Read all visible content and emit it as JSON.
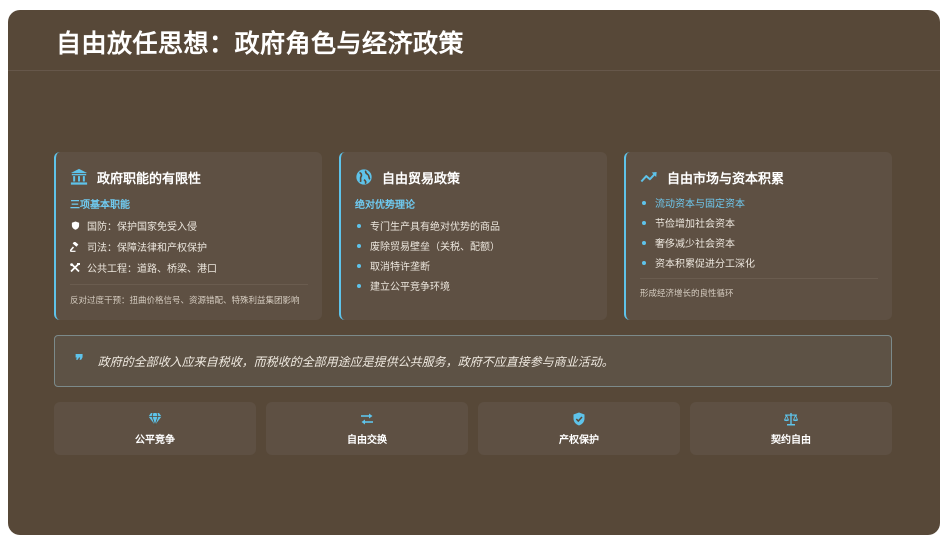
{
  "title": "自由放任思想：政府角色与经济政策",
  "cards": [
    {
      "icon": "government-building-icon",
      "title": "政府职能的有限性",
      "subhead": "三项基本职能",
      "items": [
        {
          "icon": "shield-icon",
          "text": "国防：保护国家免受入侵"
        },
        {
          "icon": "gavel-icon",
          "text": "司法：保障法律和产权保护"
        },
        {
          "icon": "tools-icon",
          "text": "公共工程：道路、桥梁、港口"
        }
      ],
      "note": "反对过度干预：扭曲价格信号、资源错配、特殊利益集团影响"
    },
    {
      "icon": "globe-icon",
      "title": "自由贸易政策",
      "subhead": "绝对优势理论",
      "items": [
        {
          "text": "专门生产具有绝对优势的商品"
        },
        {
          "text": "废除贸易壁垒（关税、配额）"
        },
        {
          "text": "取消特许垄断"
        },
        {
          "text": "建立公平竞争环境"
        }
      ]
    },
    {
      "icon": "trending-up-icon",
      "title": "自由市场与资本积累",
      "items": [
        {
          "text": "流动资本与固定资本",
          "highlight": true
        },
        {
          "text": "节俭增加社会资本"
        },
        {
          "text": "奢侈减少社会资本"
        },
        {
          "text": "资本积累促进分工深化"
        }
      ],
      "note": "形成经济增长的良性循环"
    }
  ],
  "quote": {
    "icon": "quote-icon",
    "mark": "❞",
    "text": "政府的全部收入应来自税收，而税收的全部用途应是提供公共服务，政府不应直接参与商业活动。"
  },
  "principles": [
    {
      "icon": "diamond-icon",
      "label": "公平竞争"
    },
    {
      "icon": "exchange-icon",
      "label": "自由交换"
    },
    {
      "icon": "shield-check-icon",
      "label": "产权保护"
    },
    {
      "icon": "scale-icon",
      "label": "契约自由"
    }
  ],
  "colors": {
    "background": "#574838",
    "card": "#5e5043",
    "accent": "#5ec3ea",
    "text": "#ffffff"
  }
}
